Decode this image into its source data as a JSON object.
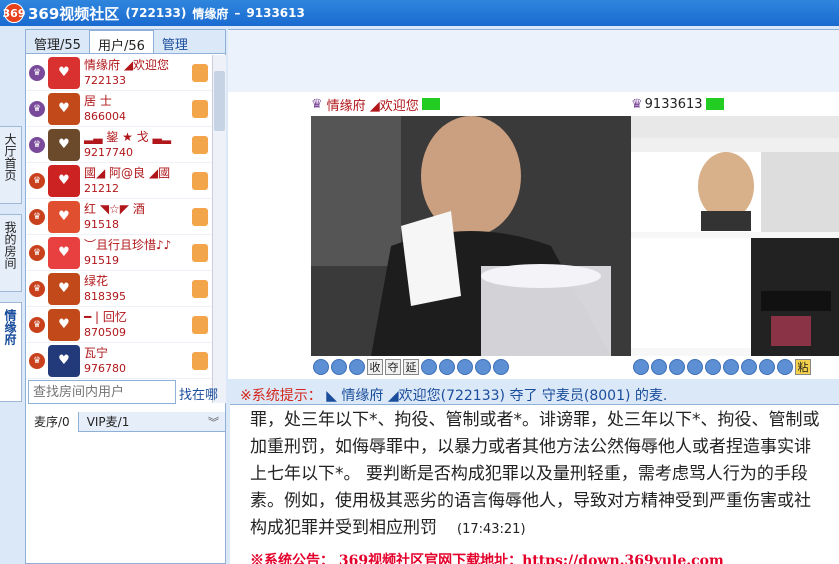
{
  "window": {
    "logo_text": "369",
    "app_title": "369视频社区",
    "room_id": "(722133)",
    "room_name": "情缘府",
    "separator": "–",
    "room_number": "9133613"
  },
  "left_tabs": [
    "大厅首页",
    "我的房间",
    "情缘府"
  ],
  "user_panel": {
    "tabs": [
      "管理/55",
      "用户/56",
      "管理"
    ],
    "users": [
      {
        "name": "情缘府 ◢欢迎您",
        "id": "722133",
        "avatar_color": "#d93030",
        "crown_color": "#7a4a9a"
      },
      {
        "name": "居 士",
        "id": "866004",
        "avatar_color": "#c24a1a",
        "crown_color": "#7a4a9a"
      },
      {
        "name": "▂▃ 鋆 ★ 戈 ▃▂",
        "id": "9217740",
        "avatar_color": "#6a4a2a",
        "crown_color": "#7a4a9a"
      },
      {
        "name": "國◢ 阿@良 ◢國",
        "id": "21212",
        "avatar_color": "#cc2222",
        "crown_color": "#c8401c"
      },
      {
        "name": "红 ◥☆◤ 酒",
        "id": "91518",
        "avatar_color": "#e05030",
        "crown_color": "#c8401c"
      },
      {
        "name": "︶且行且珍惜♪♪",
        "id": "91519",
        "avatar_color": "#e84040",
        "crown_color": "#c8401c"
      },
      {
        "name": "绿花",
        "id": "818395",
        "avatar_color": "#c24a1a",
        "crown_color": "#c8401c"
      },
      {
        "name": "━ | 回忆",
        "id": "870509",
        "avatar_color": "#c24a1a",
        "crown_color": "#c8401c"
      },
      {
        "name": "瓦宁",
        "id": "976780",
        "avatar_color": "#223a7a",
        "crown_color": "#c8401c"
      }
    ],
    "search_placeholder": "查找房间内用户",
    "search_button": "找在哪",
    "queue_tabs": [
      "麦序/0",
      "VIP麦/1"
    ]
  },
  "video": {
    "left_header": "情缘府 ◢欢迎您",
    "right_header": "9133613",
    "controls": [
      "收",
      "夺",
      "延",
      "粘"
    ]
  },
  "system_line": {
    "prefix": "※系统提示：",
    "text": "◣ 情缘府 ◢欢迎您(722133) 夺了 守麦员(8001) 的麦."
  },
  "chat": {
    "lines": [
      "罪，处三年以下*、拘役、管制或者*。诽谤罪，处三年以下*、拘役、管制或",
      "加重刑罚，如侮辱罪中，以暴力或者其他方法公然侮辱他人或者捏造事实诽",
      "上七年以下*。 要判断是否构成犯罪以及量刑轻重，需考虑骂人行为的手段",
      "素。例如，使用极其恶劣的语言侮辱他人，导致对方精神受到严重伤害或社",
      "构成犯罪并受到相应刑罚"
    ],
    "timestamp": "(17:43:21)",
    "notice": "※系统公告： 369视频社区官网下载地址：https://down.369yule.com"
  }
}
